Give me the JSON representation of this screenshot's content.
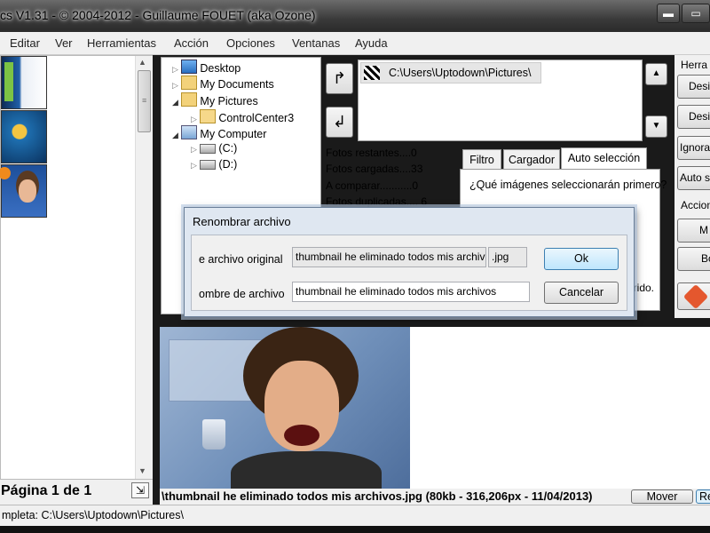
{
  "window": {
    "title": "cs V1.31 - © 2004-2012 - Guillaume FOUET (aka Ozone)",
    "minimize_glyph": "▬",
    "maximize_glyph": "▭"
  },
  "menu": [
    "Editar",
    "Ver",
    "Herramientas",
    "Acción",
    "Opciones",
    "Ventanas",
    "Ayuda"
  ],
  "tree": {
    "items": [
      {
        "label": "Desktop",
        "icon": "desktop-icon"
      },
      {
        "label": "My Documents",
        "icon": "documents-folder-icon"
      },
      {
        "label": "My Pictures",
        "icon": "pictures-folder-icon"
      },
      {
        "label": "ControlCenter3",
        "icon": "folder-icon"
      },
      {
        "label": "My Computer",
        "icon": "computer-icon"
      },
      {
        "label": "(C:)",
        "icon": "drive-icon"
      },
      {
        "label": "(D:)",
        "icon": "drive-icon"
      }
    ]
  },
  "folder_list": {
    "path": "C:\\Users\\Uptodown\\Pictures\\"
  },
  "stats": {
    "remaining": "Fotos restantes....0",
    "loaded": "Fotos cargadas....33",
    "to_compare": "A comparar...........0",
    "duplicates": "Fotos duplicadas.... 6"
  },
  "tabs": [
    "Filtro",
    "Cargador",
    "Auto selección"
  ],
  "auto_select": {
    "question": "¿Qué imágenes seleccionarán primero?",
    "partial_text": "erido."
  },
  "right_panel": {
    "tools_header": "Herra",
    "btn1": "Desi",
    "btn2": "Desi",
    "btn3": "Ignora",
    "btn4": "Auto s",
    "actions_header": "Accion",
    "btn5": "M",
    "btn6": "Bo"
  },
  "dialog": {
    "title": "Renombrar archivo",
    "original_label": "e archivo original",
    "original_value": "thumbnail he eliminado todos mis archiv",
    "extension": ".jpg",
    "new_label": "ombre de archivo",
    "new_value": "thumbnail he eliminado todos mis archivos",
    "ok": "Ok",
    "cancel": "Cancelar"
  },
  "preview": {
    "caption": "\\thumbnail he eliminado todos mis archivos.jpg (80kb - 316,206px - 11/04/2013)",
    "move": "Mover",
    "rename_partial": "Re"
  },
  "pager": {
    "label": "Página 1 de 1"
  },
  "status": {
    "text": "mpleta: C:\\Users\\Uptodown\\Pictures\\"
  },
  "colors": {
    "accent": "#2f6fc4",
    "dialog_border": "#6a7f99",
    "title_gradient_dark": "#2a2a2a"
  }
}
